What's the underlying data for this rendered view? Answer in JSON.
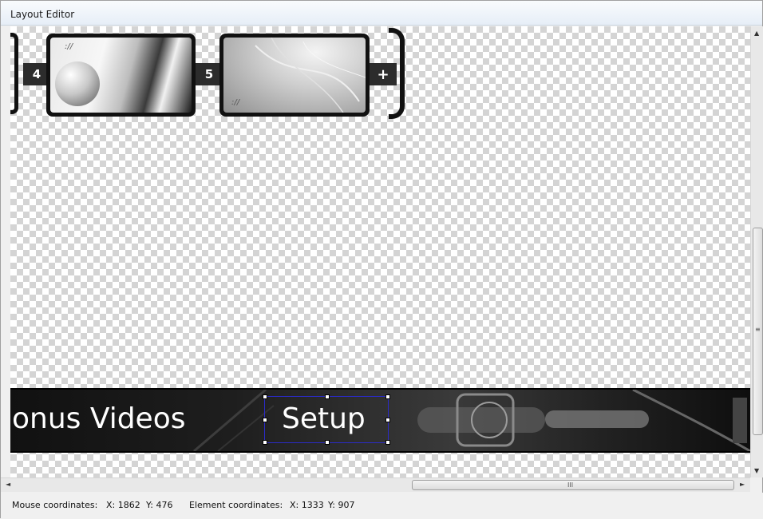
{
  "window": {
    "title": "Layout Editor"
  },
  "thumbnails": [
    {
      "number": "4",
      "mark": "://"
    },
    {
      "number": "5",
      "mark": "://"
    }
  ],
  "add_tab": {
    "label": "+"
  },
  "menu": {
    "items": [
      {
        "label": "onus Videos"
      },
      {
        "label": "Setup",
        "selected": true
      }
    ]
  },
  "scrollbars": {
    "up_arrow": "▲",
    "down_arrow": "▼",
    "left_arrow": "◄",
    "right_arrow": "►",
    "v_grip": "≡",
    "h_grip": "III"
  },
  "status": {
    "mouse_label": "Mouse coordinates:",
    "mouse_x": "X:  1862",
    "mouse_y": "Y:  476",
    "element_label": "Element coordinates:",
    "element_x": "X:  1333",
    "element_y": "Y:  907"
  },
  "colors": {
    "selection_border": "#2b2bc8",
    "menu_text": "#ffffff",
    "checker_dark": "#d4d4d4"
  }
}
